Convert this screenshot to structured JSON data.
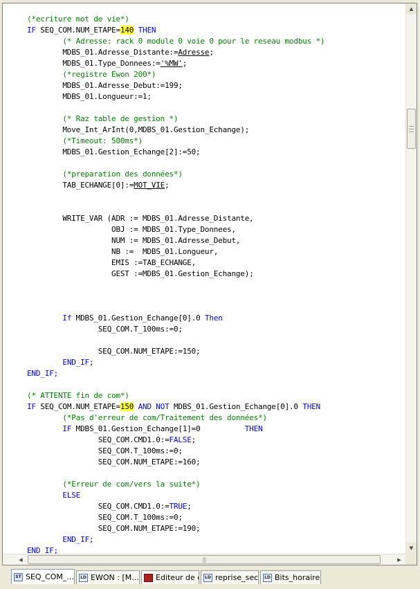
{
  "code_lines": [
    [
      {
        "t": "(*ecriture mot de vie*)",
        "c": "cm"
      }
    ],
    [
      {
        "t": "IF",
        "c": "kw"
      },
      {
        "t": " SEQ_COM.NUM_ETAPE="
      },
      {
        "t": "140",
        "c": "hl"
      },
      {
        "t": " "
      },
      {
        "t": "THEN",
        "c": "kw"
      }
    ],
    [
      {
        "t": "        (* Adresse: rack 0 module 0 voie 0 pour le reseau modbus *)",
        "c": "cm"
      }
    ],
    [
      {
        "t": "        MDBS_01.Adresse_Distante:="
      },
      {
        "t": "Adresse",
        "c": "ul"
      },
      {
        "t": ";"
      }
    ],
    [
      {
        "t": "        MDBS_01.Type_Donnees:="
      },
      {
        "t": "'%MW'",
        "c": "ul"
      },
      {
        "t": ";"
      }
    ],
    [
      {
        "t": "        (*registre Ewon 200*)",
        "c": "cm"
      }
    ],
    [
      {
        "t": "        MDBS_01.Adresse_Debut:=199;"
      }
    ],
    [
      {
        "t": "        MDBS_01.Longueur:=1;"
      }
    ],
    [
      {
        "t": ""
      }
    ],
    [
      {
        "t": "        (* Raz table de gestion *)",
        "c": "cm"
      }
    ],
    [
      {
        "t": "        Move_Int_ArInt(0,MDBS_01.Gestion_Echange);"
      }
    ],
    [
      {
        "t": "        (*Timeout: 500ms*)",
        "c": "cm"
      }
    ],
    [
      {
        "t": "        MDBS_01.Gestion_Echange[2]:=50;"
      }
    ],
    [
      {
        "t": ""
      }
    ],
    [
      {
        "t": "        (*preparation des données*)",
        "c": "cm"
      }
    ],
    [
      {
        "t": "        TAB_ECHANGE[0]:="
      },
      {
        "t": "MOT_VIE",
        "c": "ul"
      },
      {
        "t": ";"
      }
    ],
    [
      {
        "t": ""
      }
    ],
    [
      {
        "t": ""
      }
    ],
    [
      {
        "t": "        WRITE_VAR (ADR := MDBS_01.Adresse_Distante,"
      }
    ],
    [
      {
        "t": "                   OBJ := MDBS_01.Type_Donnees,"
      }
    ],
    [
      {
        "t": "                   NUM := MDBS_01.Adresse_Debut,"
      }
    ],
    [
      {
        "t": "                   NB :=  MDBS_01.Longueur,"
      }
    ],
    [
      {
        "t": "                   EMIS :=TAB_ECHANGE,"
      }
    ],
    [
      {
        "t": "                   GEST :=MDBS_01.Gestion_Echange);"
      }
    ],
    [
      {
        "t": ""
      }
    ],
    [
      {
        "t": ""
      }
    ],
    [
      {
        "t": ""
      }
    ],
    [
      {
        "t": "        "
      },
      {
        "t": "If",
        "c": "kw"
      },
      {
        "t": " MDBS_01.Gestion_Echange[0].0 "
      },
      {
        "t": "Then",
        "c": "kw"
      }
    ],
    [
      {
        "t": "                SEQ_COM.T_100ms:=0;"
      }
    ],
    [
      {
        "t": ""
      }
    ],
    [
      {
        "t": "                SEQ_COM.NUM_ETAPE:=150;"
      }
    ],
    [
      {
        "t": "        "
      },
      {
        "t": "END_IF;",
        "c": "kw"
      }
    ],
    [
      {
        "t": "END_IF;",
        "c": "kw"
      }
    ],
    [
      {
        "t": ""
      }
    ],
    [
      {
        "t": "(* ATTENTE fin de com*)",
        "c": "cm"
      }
    ],
    [
      {
        "t": "IF",
        "c": "kw"
      },
      {
        "t": " SEQ_COM.NUM_ETAPE="
      },
      {
        "t": "150",
        "c": "hl"
      },
      {
        "t": " "
      },
      {
        "t": "AND NOT",
        "c": "kw"
      },
      {
        "t": " MDBS_01.Gestion_Echange[0].0 "
      },
      {
        "t": "THEN",
        "c": "kw"
      }
    ],
    [
      {
        "t": "        (*Pas d'erreur de com/Traitement des données*)",
        "c": "cm"
      }
    ],
    [
      {
        "t": "        "
      },
      {
        "t": "IF",
        "c": "kw"
      },
      {
        "t": " MDBS_01.Gestion_Echange[1]=0          "
      },
      {
        "t": "THEN",
        "c": "kw"
      }
    ],
    [
      {
        "t": "                SEQ_COM.CMD1.0:="
      },
      {
        "t": "FALSE",
        "c": "kw"
      },
      {
        "t": ";"
      }
    ],
    [
      {
        "t": "                SEQ_COM.T_100ms:=0;"
      }
    ],
    [
      {
        "t": "                SEQ_COM.NUM_ETAPE:=160;"
      }
    ],
    [
      {
        "t": ""
      }
    ],
    [
      {
        "t": "        (*Erreur de com/vers la suite*)",
        "c": "cm"
      }
    ],
    [
      {
        "t": "        "
      },
      {
        "t": "ELSE",
        "c": "kw"
      }
    ],
    [
      {
        "t": "                SEQ_COM.CMD1.0:="
      },
      {
        "t": "TRUE",
        "c": "kw"
      },
      {
        "t": ";"
      }
    ],
    [
      {
        "t": "                SEQ_COM.T_100ms:=0;"
      }
    ],
    [
      {
        "t": "                SEQ_COM.NUM_ETAPE:=190;"
      }
    ],
    [
      {
        "t": "        "
      },
      {
        "t": "END_IF;",
        "c": "kw"
      }
    ],
    [
      {
        "t": "END_IF;",
        "c": "kw"
      }
    ]
  ],
  "scrollbar": {
    "up_arrow": "▲",
    "down_arrow": "▼",
    "left_arrow": "◀",
    "right_arrow": "▶",
    "h_grip": "|||"
  },
  "tabs": [
    {
      "label": "SEQ_COM_...",
      "icon": "st-language-icon",
      "icon_text": "ST",
      "active": true
    },
    {
      "label": "EWON : [M...",
      "icon": "ld-language-icon",
      "icon_text": "LD",
      "active": false
    },
    {
      "label": "Editeur de d...",
      "icon": "data-editor-icon",
      "icon_text": "",
      "active": false
    },
    {
      "label": "reprise_sect...",
      "icon": "ld-language-icon",
      "icon_text": "LD",
      "active": false
    },
    {
      "label": "Bits_horaire...",
      "icon": "ld-language-icon",
      "icon_text": "LD",
      "active": false
    }
  ]
}
